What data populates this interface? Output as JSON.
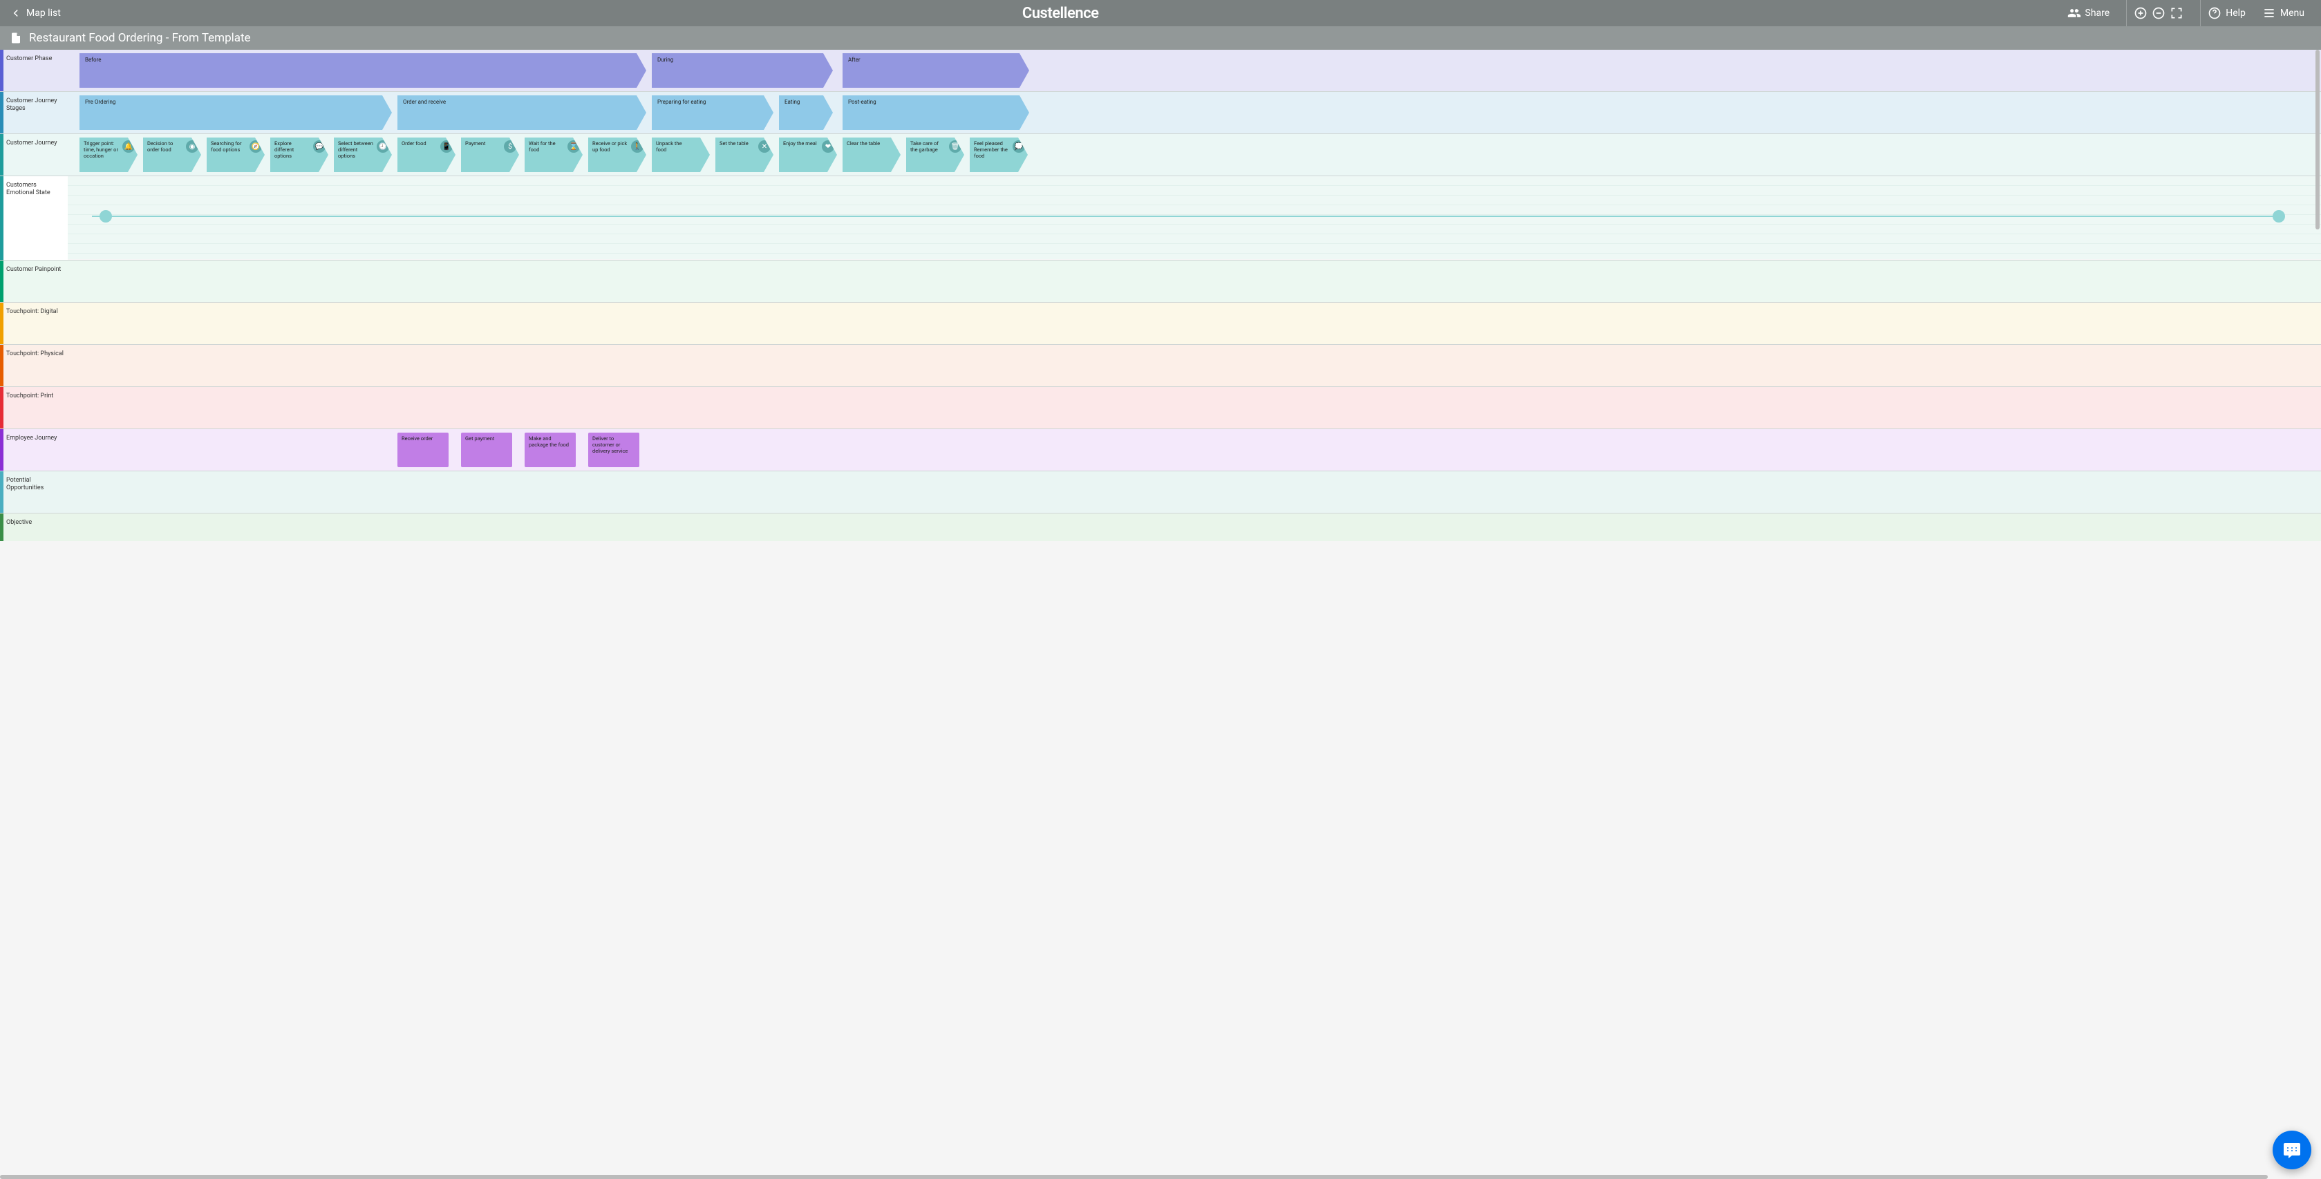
{
  "header": {
    "back_label": "Map list",
    "logo": "Custellence",
    "share_label": "Share",
    "help_label": "Help",
    "menu_label": "Menu"
  },
  "titlebar": {
    "title": "Restaurant Food Ordering - From Template"
  },
  "lanes": {
    "phase": "Customer Phase",
    "stages": "Customer Journey Stages",
    "journey": "Customer Journey",
    "emotional": "Customers Emotional State",
    "painpoint": "Customer Painpoint",
    "digital": "Touchpoint: Digital",
    "physical": "Touchpoint: Physical",
    "print": "Touchpoint: Print",
    "employee": "Employee Journey",
    "opportunities": "Potential Opportunities",
    "objective": "Objective"
  },
  "phases": [
    {
      "label": "Before"
    },
    {
      "label": "During"
    },
    {
      "label": "After"
    }
  ],
  "stages": [
    {
      "label": "Pre Ordering"
    },
    {
      "label": "Order and receive"
    },
    {
      "label": "Preparing for eating"
    },
    {
      "label": "Eating"
    },
    {
      "label": "Post-eating"
    }
  ],
  "journey": [
    {
      "label": "Trigger point: time, hunger or occation",
      "icon": "🔔"
    },
    {
      "label": "Decision to order food",
      "icon": "◉"
    },
    {
      "label": "Searching for food options",
      "icon": "🧭"
    },
    {
      "label": "Explore different options",
      "icon": "💬"
    },
    {
      "label": "Select between different options",
      "icon": "🕘"
    },
    {
      "label": "Order food",
      "icon": "📱"
    },
    {
      "label": "Payment",
      "icon": "$"
    },
    {
      "label": "Wait for the food",
      "icon": "⌛"
    },
    {
      "label": "Receive or pick up food",
      "icon": "🚶"
    },
    {
      "label": "Unpack the food",
      "icon": ""
    },
    {
      "label": "Set the table",
      "icon": "✕"
    },
    {
      "label": "Enjoy the meal",
      "icon": "❤"
    },
    {
      "label": "Clear the table",
      "icon": ""
    },
    {
      "label": "Take care of the garbage",
      "icon": "🗑"
    },
    {
      "label": "Feel pleased Remember the food",
      "icon": "💭"
    }
  ],
  "employee": [
    {
      "label": "Receive order"
    },
    {
      "label": "Get payment"
    },
    {
      "label": "Make and package the food"
    },
    {
      "label": "Deliver to customer or delivery service"
    }
  ],
  "colors": {
    "phase": "#9397e0",
    "stage": "#8fc9e8",
    "journey": "#8fd5d5",
    "employee": "#c17ee6",
    "strip_phase": "#5a5fd4",
    "strip_stage": "#2a8db7",
    "strip_journey": "#1f9c9c",
    "strip_emo": "#1f9c9c",
    "strip_pain": "#00a06e",
    "strip_digital": "#f0a000",
    "strip_physical": "#e65d00",
    "strip_print": "#e62c36",
    "strip_employee": "#8b2ed4",
    "strip_opp": "#4aaec0",
    "strip_obj": "#3a8e47"
  }
}
